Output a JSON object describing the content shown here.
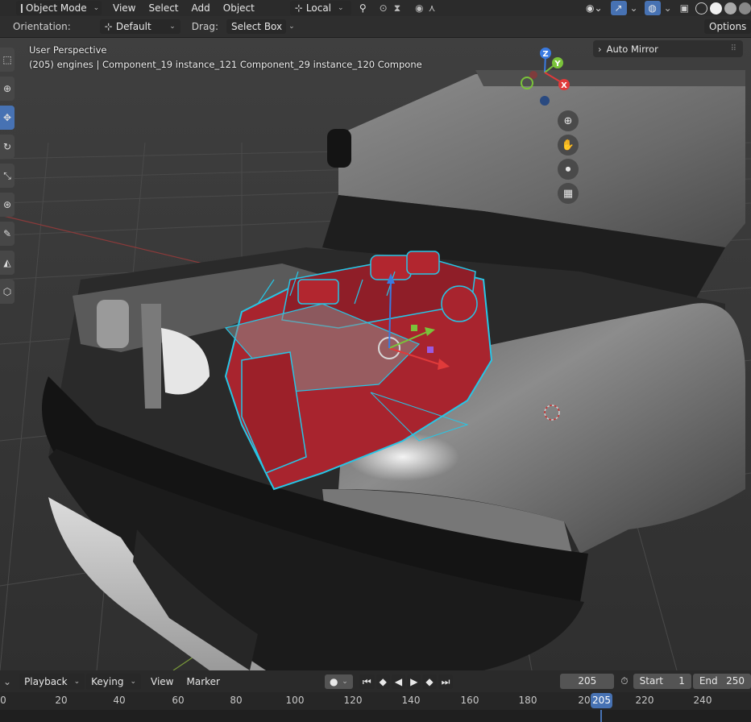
{
  "header": {
    "mode": "Object Mode",
    "menus": [
      "View",
      "Select",
      "Add",
      "Object"
    ],
    "transform_orientation": "Local"
  },
  "tool_settings": {
    "orientation_label": "Orientation:",
    "orientation_value": "Default",
    "drag_label": "Drag:",
    "drag_value": "Select Box",
    "options": "Options"
  },
  "viewport": {
    "view_name": "User Perspective",
    "info": "(205) engines | Component_19 instance_121 Component_29 instance_120 Compone",
    "auto_mirror": "Auto Mirror",
    "gizmo_axes": {
      "z": "Z",
      "y": "Y",
      "x": "X"
    }
  },
  "timeline": {
    "menus": [
      "Playback",
      "Keying",
      "View",
      "Marker"
    ],
    "current_frame": "205",
    "start_label": "Start",
    "start_value": "1",
    "end_label": "End",
    "end_value": "250",
    "ruler": [
      "0",
      "20",
      "40",
      "60",
      "80",
      "100",
      "120",
      "140",
      "160",
      "180",
      "20",
      "220",
      "240"
    ],
    "playhead": "205"
  },
  "colors": {
    "accent": "#4772b3",
    "selection_outline": "#27c6e6",
    "engine_red": "#a8242e",
    "playhead": "#4772b3"
  }
}
